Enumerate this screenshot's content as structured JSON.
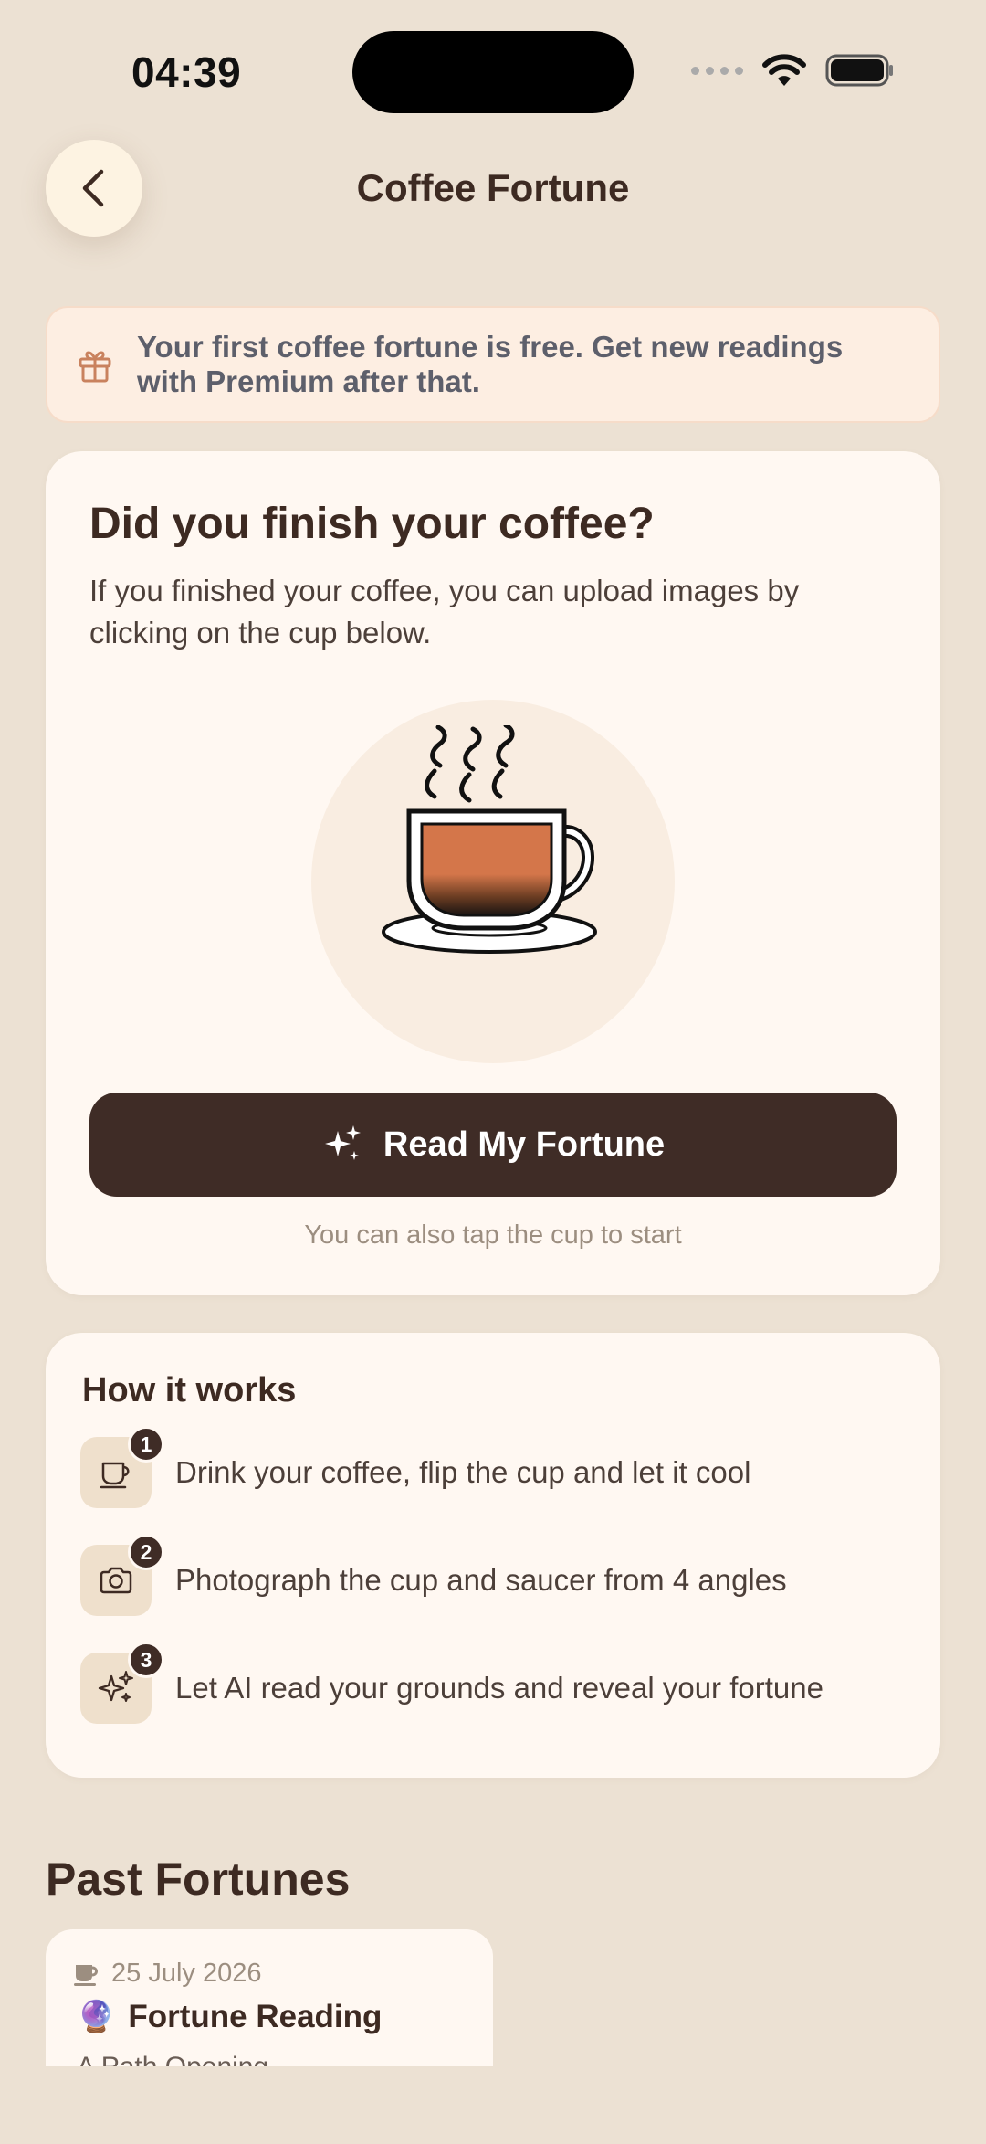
{
  "status_bar": {
    "time": "04:39"
  },
  "header": {
    "title": "Coffee Fortune",
    "back_icon": "chevron-left-icon"
  },
  "promo": {
    "text": "Your first coffee fortune is free. Get new readings with Premium after that.",
    "icon": "gift-icon"
  },
  "main_card": {
    "title": "Did you finish your coffee?",
    "description": "If you finished your coffee, you can upload images by clicking on the cup below.",
    "cta_label": "Read My Fortune",
    "cta_icon": "sparkles-icon",
    "hint": "You can also tap the cup to start"
  },
  "how_it_works": {
    "title": "How it works",
    "steps": [
      {
        "number": "1",
        "icon": "cup-icon",
        "text": "Drink your coffee, flip the cup and let it cool"
      },
      {
        "number": "2",
        "icon": "camera-icon",
        "text": "Photograph the cup and saucer from 4 angles"
      },
      {
        "number": "3",
        "icon": "sparkles-icon",
        "text": "Let AI read your grounds and reveal your fortune"
      }
    ]
  },
  "past_fortunes": {
    "title": "Past Fortunes",
    "items": [
      {
        "date": "25 July 2026",
        "emoji": "🔮",
        "title": "Fortune Reading",
        "subtitle": "A Path Opening"
      }
    ]
  },
  "colors": {
    "background": "#ece1d3",
    "card": "#fff8f2",
    "primary_dark": "#3f2c26",
    "coffee": "#d4764a"
  }
}
